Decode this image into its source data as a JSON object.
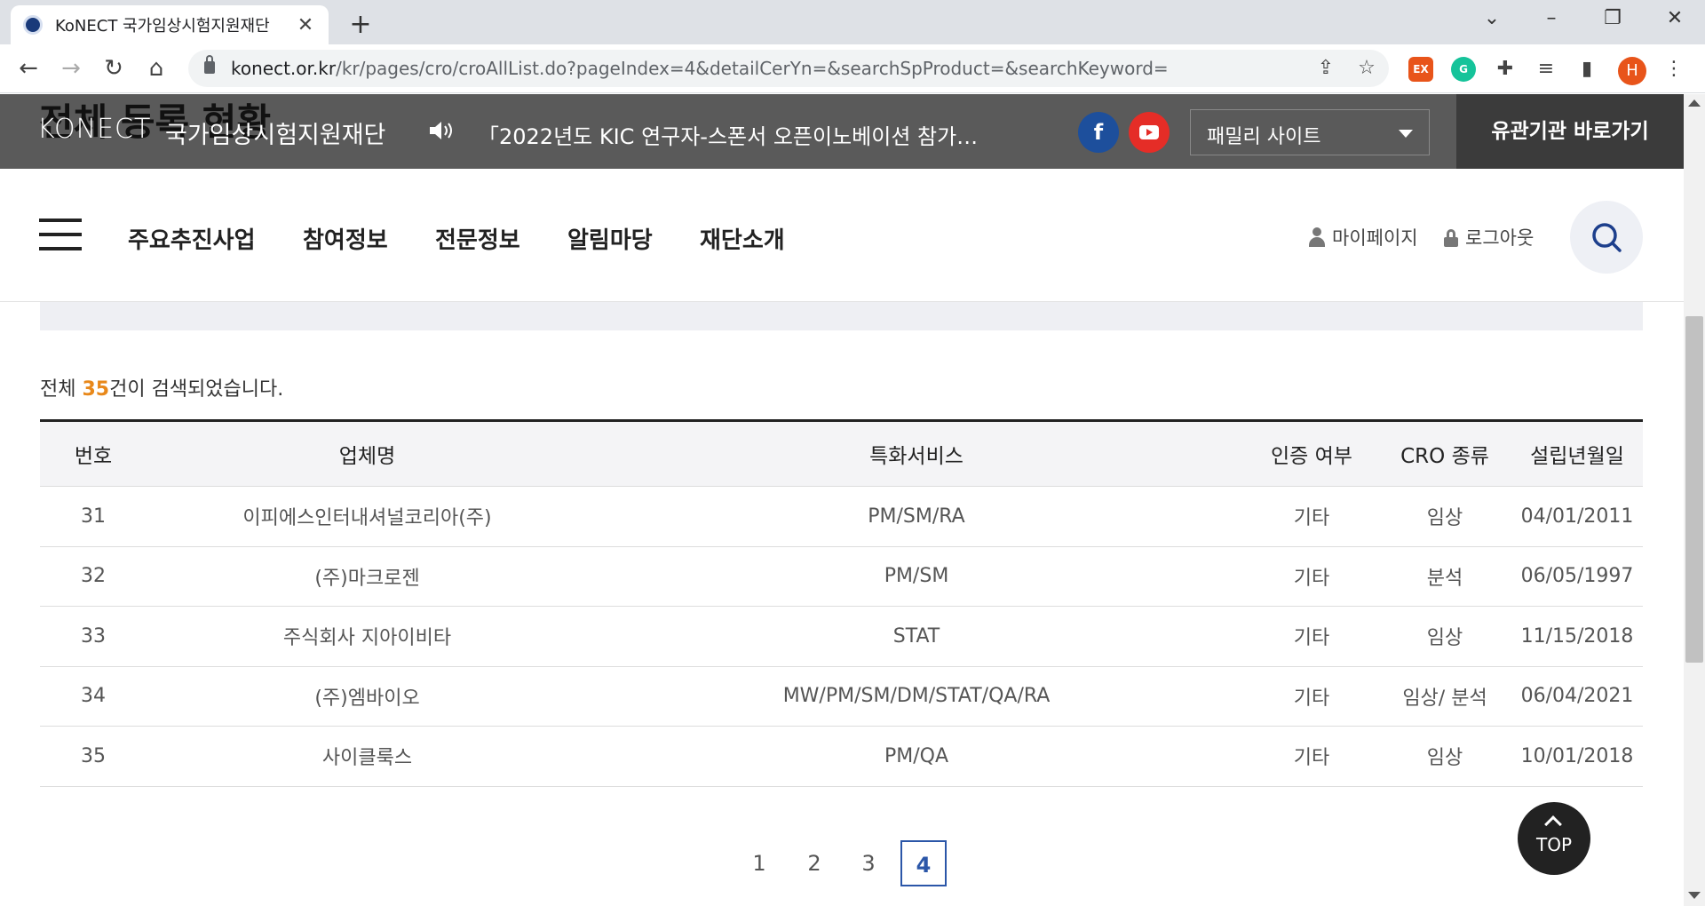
{
  "browser": {
    "tab_title": "KoNECT 국가임상시험지원재단",
    "tab_close": "✕",
    "new_tab": "+",
    "url_host": "konect.or.kr",
    "url_path": "/kr/pages/cro/croAllList.do?pageIndex=4&detailCerYn=&searchSpProduct=&searchKeyword=",
    "profile_initial": "H",
    "ext_label": "EX"
  },
  "header": {
    "behind_title": "전체 등록 현황",
    "logo_text": "KONECT",
    "logo_sub": "국가임상시험지원재단",
    "notice": "「2022년도 KIC 연구자-스폰서 오픈이노베이션 참가…",
    "facebook": "f",
    "family_site": "패밀리 사이트",
    "related_link": "유관기관 바로가기"
  },
  "nav": {
    "items": [
      "주요추진사업",
      "참여정보",
      "전문정보",
      "알림마당",
      "재단소개"
    ],
    "mypage": "마이페이지",
    "logout": "로그아웃"
  },
  "content": {
    "count_prefix": "전체 ",
    "count_value": "35",
    "count_suffix": "건이 검색되었습니다.",
    "columns": [
      "번호",
      "업체명",
      "특화서비스",
      "인증 여부",
      "CRO 종류",
      "설립년월일"
    ],
    "rows": [
      [
        "31",
        "이피에스인터내셔널코리아(주)",
        "PM/SM/RA",
        "기타",
        "임상",
        "04/01/2011"
      ],
      [
        "32",
        "(주)마크로젠",
        "PM/SM",
        "기타",
        "분석",
        "06/05/1997"
      ],
      [
        "33",
        "주식회사 지아이비타",
        "STAT",
        "기타",
        "임상",
        "11/15/2018"
      ],
      [
        "34",
        "(주)엠바이오",
        "MW/PM/SM/DM/STAT/QA/RA",
        "기타",
        "임상/ 분석",
        "06/04/2021"
      ],
      [
        "35",
        "사이클룩스",
        "PM/QA",
        "기타",
        "임상",
        "10/01/2018"
      ]
    ]
  },
  "pagination": {
    "pages": [
      "1",
      "2",
      "3",
      "4"
    ],
    "current": "4"
  },
  "top_button": "TOP"
}
